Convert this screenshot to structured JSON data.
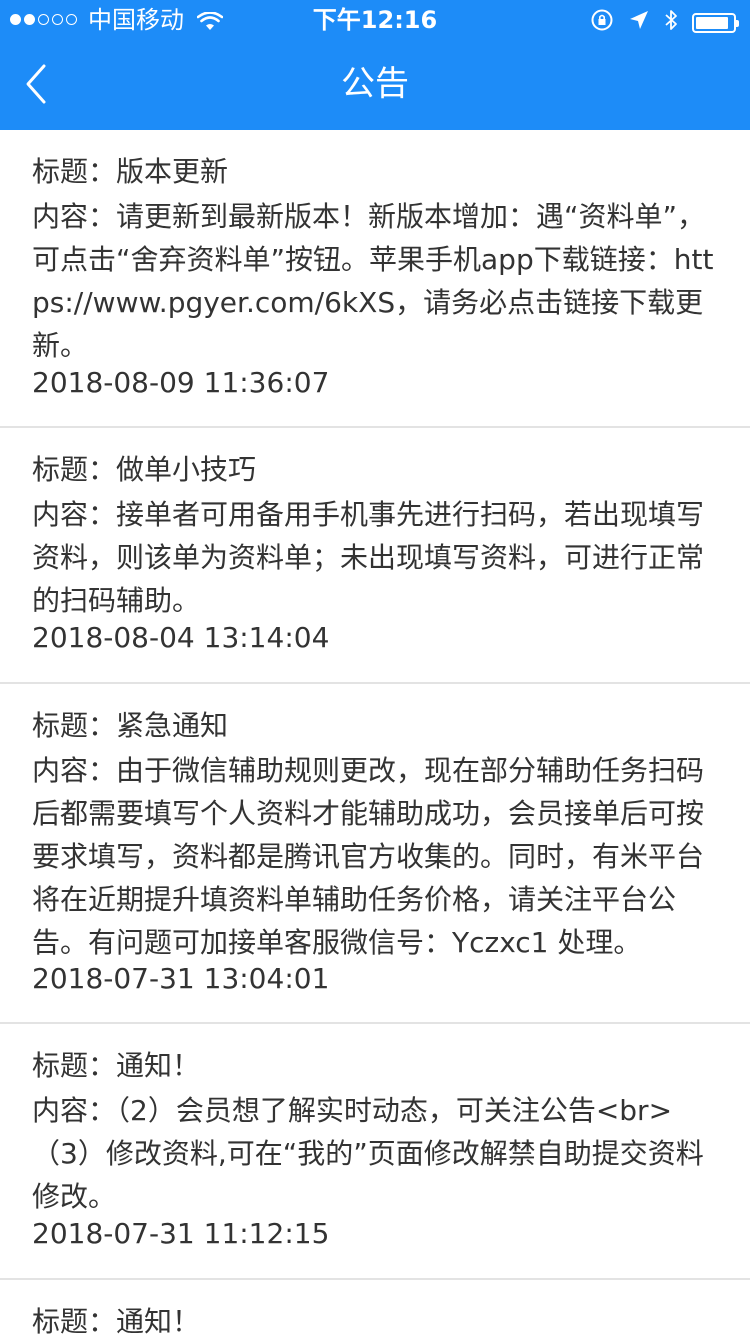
{
  "status_bar": {
    "carrier": "中国移动",
    "time": "下午12:16",
    "signal_bars_filled": 2,
    "signal_bars_total": 5,
    "battery_level": 0.9
  },
  "nav": {
    "title": "公告",
    "back_icon": "chevron-left-icon"
  },
  "colors": {
    "header_bg": "#1d8cf8",
    "divider": "#e3e3e3",
    "text": "#333333"
  },
  "notices": [
    {
      "title": "标题：版本更新",
      "content": "内容：请更新到最新版本！新版本增加：遇“资料单”，可点击“舍弃资料单”按钮。苹果手机app下载链接：https://www.pgyer.com/6kXS，请务必点击链接下载更新。",
      "date": "2018-08-09 11:36:07"
    },
    {
      "title": "标题：做单小技巧",
      "content": "内容：接单者可用备用手机事先进行扫码，若出现填写资料，则该单为资料单；未出现填写资料，可进行正常的扫码辅助。",
      "date": "2018-08-04 13:14:04"
    },
    {
      "title": "标题：紧急通知",
      "content": "内容：由于微信辅助规则更改，现在部分辅助任务扫码后都需要填写个人资料才能辅助成功，会员接单后可按要求填写，资料都是腾讯官方收集的。同时，有米平台将在近期提升填资料单辅助任务价格，请关注平台公告。有问题可加接单客服微信号：Yczxc1 处理。",
      "date": "2018-07-31 13:04:01"
    },
    {
      "title": "标题：通知！",
      "content": "内容：（2）会员想了解实时动态，可关注公告<br>（3）修改资料,可在“我的”页面修改解禁自助提交资料修改。",
      "date": "2018-07-31 11:12:15"
    },
    {
      "title": "标题：通知！",
      "content": "",
      "date": ""
    }
  ]
}
